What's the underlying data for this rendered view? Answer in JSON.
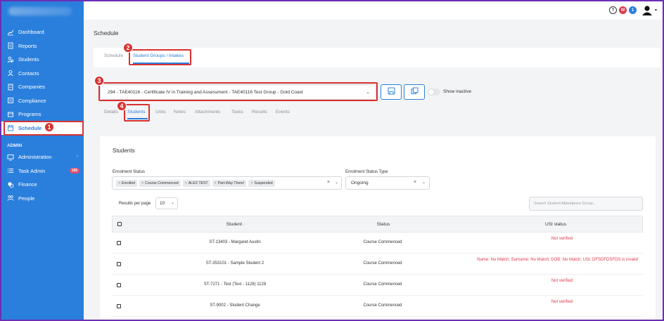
{
  "colors": {
    "primary": "#2a7fdc",
    "annotation": "#d9312f",
    "error": "#e0394d",
    "frame": "#6a2fb5"
  },
  "sidebar": {
    "items": [
      {
        "label": "Dashboard",
        "icon": "chart-line-icon"
      },
      {
        "label": "Reports",
        "icon": "report-icon"
      },
      {
        "label": "Students",
        "icon": "students-icon"
      },
      {
        "label": "Contacts",
        "icon": "contacts-icon"
      },
      {
        "label": "Companies",
        "icon": "building-icon"
      },
      {
        "label": "Compliance",
        "icon": "compliance-icon"
      },
      {
        "label": "Programs",
        "icon": "programs-icon"
      },
      {
        "label": "Schedule",
        "icon": "calendar-icon",
        "active": true
      }
    ],
    "admin_heading": "ADMIN",
    "admin_items": [
      {
        "label": "Administration",
        "icon": "monitor-icon"
      },
      {
        "label": "Task Admin",
        "icon": "list-icon",
        "badge": "196"
      },
      {
        "label": "Finance",
        "icon": "coins-icon"
      },
      {
        "label": "People",
        "icon": "people-icon"
      }
    ]
  },
  "topbar": {
    "help": "?",
    "badge_red": "W",
    "badge_blue": "1"
  },
  "page": {
    "title": "Schedule"
  },
  "tabs": [
    "Schedule",
    "Student Groups / Intakes"
  ],
  "group_select": {
    "value": "294 - TAE40116 - Certificate IV in Training and Assessment - TAE40116 Test Group - Gold Coast"
  },
  "show_inactive_label": "Show inactive",
  "subtabs": [
    "Details",
    "Students",
    "Units",
    "Notes",
    "Attachments",
    "Tasks",
    "Results",
    "Events"
  ],
  "students_card": {
    "title": "Students",
    "enrolment_status_label": "Enrolment Status",
    "enrolment_chips": [
      "Enrolled",
      "Course Commenced",
      "ALEX TEST",
      "Part-Way There!",
      "Suspended"
    ],
    "enrolment_type_label": "Enrolment Status Type",
    "enrolment_type_value": "Ongoing",
    "rpp_label": "Results per page",
    "rpp_value": "10",
    "search_placeholder": "Search Student Attendance Group...",
    "headers": {
      "student": "Student",
      "status": "Status",
      "usi": "USI status"
    },
    "rows": [
      {
        "student": "ST-13403 - Margaret Austin",
        "status": "Course Commenced",
        "usi": "Not verified"
      },
      {
        "student": "ST-353101 - Sample Student 2",
        "status": "Course Commenced",
        "usi": "Name: No Match; Surname: No Match; DOB: No Match; USI: DFSDFDSFDS is invalid"
      },
      {
        "student": "ST-7271 - Test (Test - 1128) 1128",
        "status": "Course Commenced",
        "usi": "Not verified"
      },
      {
        "student": "ST-9002 - Student Change",
        "status": "Course Commenced",
        "usi": "Not verified"
      }
    ]
  },
  "annotations": [
    "1",
    "2",
    "3",
    "4"
  ]
}
